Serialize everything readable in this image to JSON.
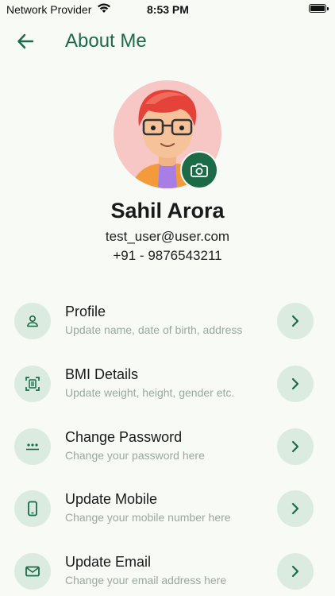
{
  "status_bar": {
    "carrier": "Network Provider",
    "time": "8:53 PM"
  },
  "header": {
    "title": "About Me"
  },
  "user": {
    "name": "Sahil Arora",
    "email": "test_user@user.com",
    "phone": "+91 - 9876543211"
  },
  "colors": {
    "accent": "#1b6b47",
    "icon_bg": "#dcebe0",
    "background": "#f7faf5"
  },
  "menu": [
    {
      "title": "Profile",
      "subtitle": "Update name, date of birth, address",
      "icon": "person-icon"
    },
    {
      "title": "BMI Details",
      "subtitle": "Update weight, height, gender etc.",
      "icon": "scan-icon"
    },
    {
      "title": "Change Password",
      "subtitle": "Change your password here",
      "icon": "password-icon"
    },
    {
      "title": "Update Mobile",
      "subtitle": "Change your mobile number here",
      "icon": "phone-icon"
    },
    {
      "title": "Update Email",
      "subtitle": "Change your email address here",
      "icon": "mail-icon"
    }
  ]
}
